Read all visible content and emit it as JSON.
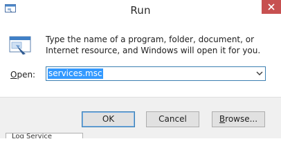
{
  "window": {
    "title": "Run",
    "icon": "run-app-icon",
    "close_icon": "close-icon",
    "close_button_color": "#c75050"
  },
  "main": {
    "icon": "run-dialog-icon",
    "description": "Type the name of a program, folder, document, or Internet resource, and Windows will open it for you.",
    "open_label_mnemonic": "O",
    "open_label_rest": "pen:",
    "open_value": "services.msc",
    "dropdown_icon": "chevron-down-icon"
  },
  "buttons": {
    "ok_label": "OK",
    "cancel_label": "Cancel",
    "browse_mnemonic": "B",
    "browse_rest": "rowse..."
  },
  "background_window": {
    "text": "Log    Service"
  },
  "colors": {
    "selection": "#3399ff",
    "focus_border": "#3c7fb1",
    "footer_bg": "#f0f0f0"
  }
}
